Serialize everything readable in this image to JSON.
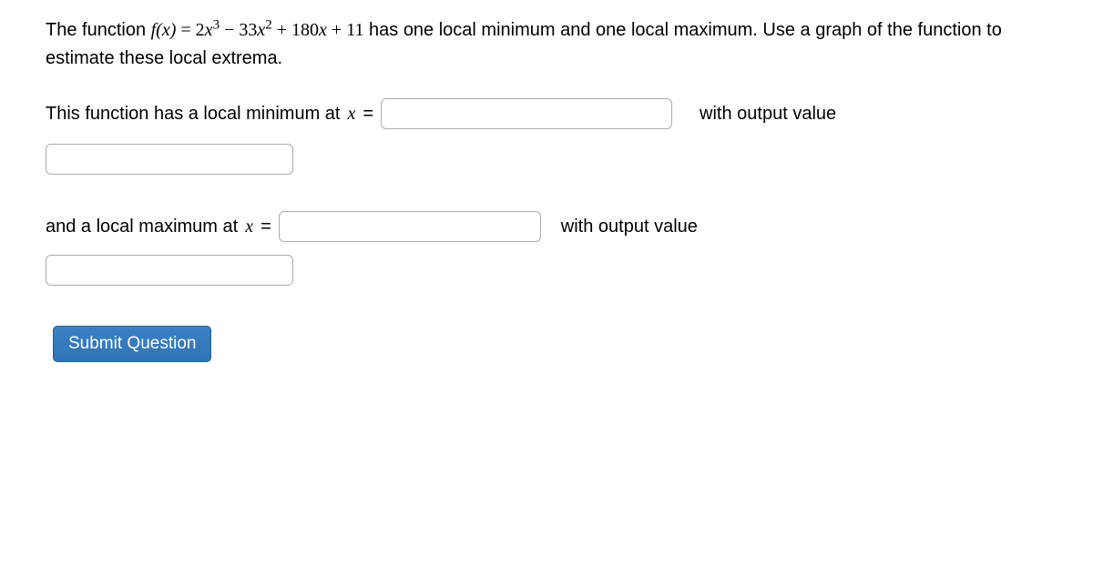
{
  "question": {
    "intro_1": "The function ",
    "f_lhs": "f(x)",
    "eq": " = ",
    "rhs_coef1": "2",
    "rhs_var1": "x",
    "rhs_exp1": "3",
    "rhs_op1": " − ",
    "rhs_coef2": "33",
    "rhs_var2": "x",
    "rhs_exp2": "2",
    "rhs_op2": " + ",
    "rhs_coef3": "180",
    "rhs_var3": "x",
    "rhs_op3": " + ",
    "rhs_const": "11",
    "intro_2": " has one local minimum and one local maximum. Use a graph of the function to estimate these local extrema."
  },
  "prompts": {
    "min_pre": "This function has a local minimum at ",
    "min_var": "x",
    "min_eq": " =",
    "with_output": "with output value",
    "max_pre": "and a local maximum at ",
    "max_var": "x",
    "max_eq": " ="
  },
  "button": {
    "submit": "Submit Question"
  }
}
